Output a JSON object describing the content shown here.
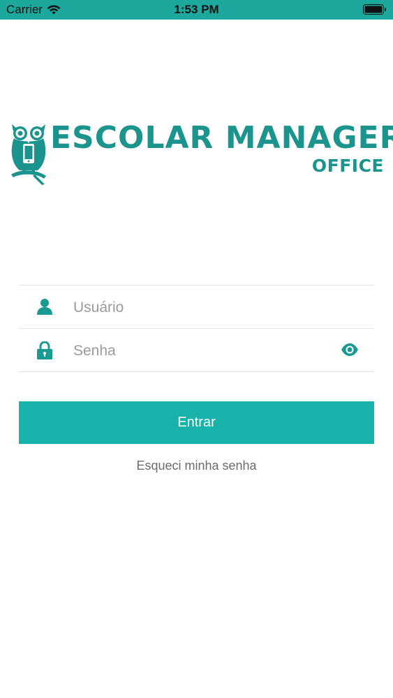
{
  "status_bar": {
    "carrier": "Carrier",
    "time": "1:53 PM",
    "background_color": "#1ca89c",
    "icons": [
      "wifi-icon",
      "battery-icon"
    ]
  },
  "brand": {
    "name": "ESCOLAR MANAGER",
    "subtitle": "OFFICE",
    "color": "#1a948c",
    "logo_icon": "owl-logo-icon"
  },
  "login_form": {
    "username": {
      "placeholder": "Usuário",
      "value": "",
      "icon": "user-icon"
    },
    "password": {
      "placeholder": "Senha",
      "value": "",
      "icon": "lock-icon",
      "toggle_icon": "eye-icon"
    },
    "submit_label": "Entrar",
    "forgot_label": "Esqueci minha senha",
    "accent_color": "#17b2aa"
  }
}
